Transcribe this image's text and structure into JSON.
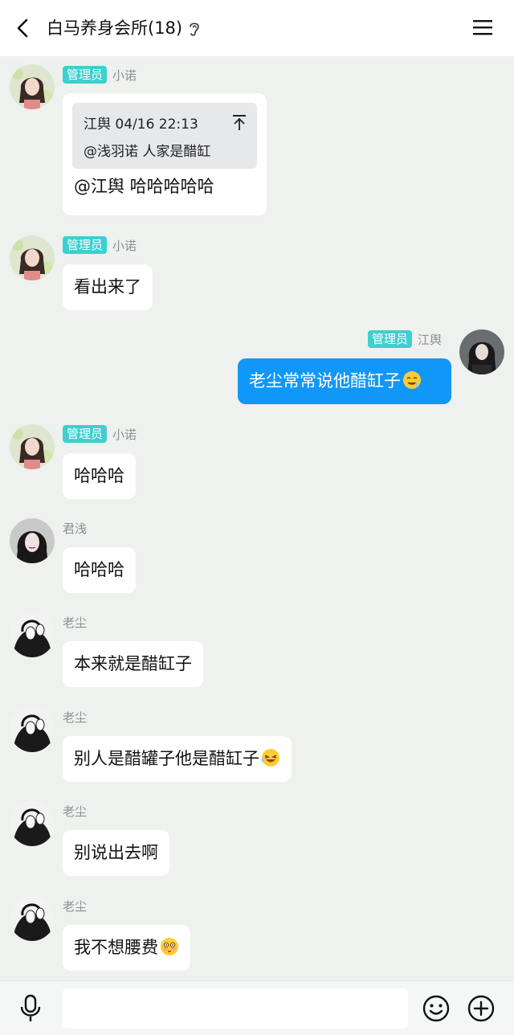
{
  "header": {
    "title": "白马养身会所(18)"
  },
  "messages": [
    {
      "sender": "小诺",
      "badge": "管理员",
      "quote": {
        "head": "江舆 04/16 22:13",
        "body": "@浅羽诺 人家是醋缸"
      },
      "text": "@江舆 哈哈哈哈哈"
    },
    {
      "sender": "小诺",
      "badge": "管理员",
      "text": "看出来了"
    },
    {
      "sender": "江舆",
      "badge": "管理员",
      "text": "老尘常常说他醋缸子"
    },
    {
      "sender": "小诺",
      "badge": "管理员",
      "text": "哈哈哈"
    },
    {
      "sender": "君浅",
      "text": "哈哈哈"
    },
    {
      "sender": "老尘",
      "text": "本来就是醋缸子"
    },
    {
      "sender": "老尘",
      "text": "别人是醋罐子他是醋缸子"
    },
    {
      "sender": "老尘",
      "text": "别说出去啊"
    },
    {
      "sender": "老尘",
      "text": "我不想腰费"
    }
  ],
  "input": {
    "placeholder": ""
  },
  "colors": {
    "accent": "#1197f7",
    "badge": "#3ecfcf",
    "background": "#eef1ee"
  }
}
